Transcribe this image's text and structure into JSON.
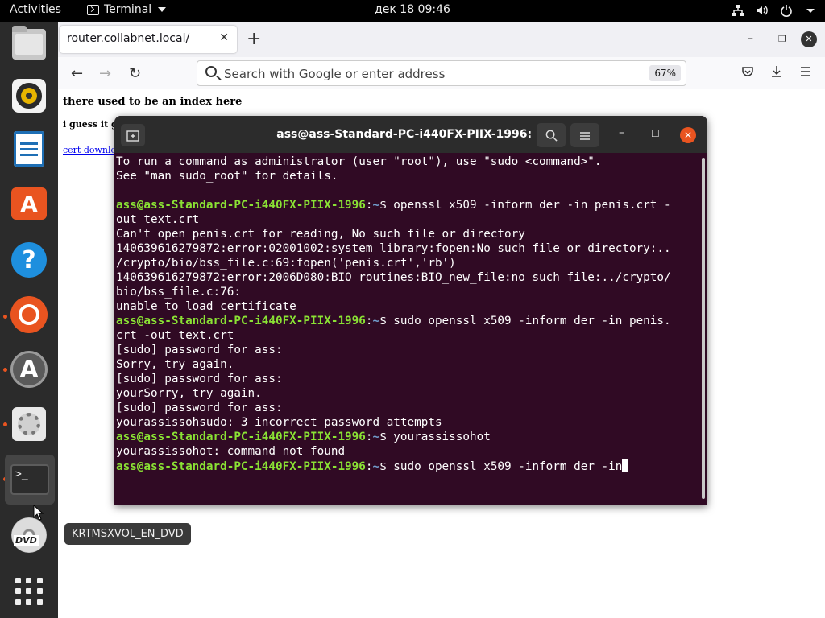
{
  "topbar": {
    "activities": "Activities",
    "app_name": "Terminal",
    "clock": "дек 18  09:46"
  },
  "dock": {
    "tooltip": "KRTMSXVOL_EN_DVD",
    "dvd_label": "DVD"
  },
  "browser": {
    "tab_title": "router.collabnet.local/",
    "url_placeholder": "Search with Google or enter address",
    "zoom": "67%",
    "page": {
      "heading": "there used to be an index here",
      "subheading": "i guess it g",
      "link": "cert downlo"
    }
  },
  "terminal": {
    "title": "ass@ass-Standard-PC-i440FX-PIIX-1996: ~",
    "lines": {
      "l1": "To run a command as administrator (user \"root\"), use \"sudo <command>\".",
      "l2": "See \"man sudo_root\" for details.",
      "prompt_user": "ass@ass-Standard-PC-i440FX-PIIX-1996",
      "prompt_sep": ":",
      "prompt_path": "~",
      "cmd1": "$ openssl x509 -inform der -in penis.crt -",
      "cmd1b": "out text.crt",
      "o1": "Can't open penis.crt for reading, No such file or directory",
      "o2": "140639616279872:error:02001002:system library:fopen:No such file or directory:..",
      "o3": "/crypto/bio/bss_file.c:69:fopen('penis.crt','rb')",
      "o4": "140639616279872:error:2006D080:BIO routines:BIO_new_file:no such file:../crypto/",
      "o5": "bio/bss_file.c:76:",
      "o6": "unable to load certificate",
      "cmd2": "$ sudo openssl x509 -inform der -in penis.",
      "cmd2b": "crt -out text.crt",
      "s1": "[sudo] password for ass:",
      "s2": "Sorry, try again.",
      "s3": "[sudo] password for ass:",
      "s4": "yourSorry, try again.",
      "s5": "[sudo] password for ass:",
      "s6": "yourassissohsudo: 3 incorrect password attempts",
      "cmd3": "$ yourassissohot",
      "o7": "yourassissohot: command not found",
      "cmd4": "$ sudo openssl x509 -inform der -in"
    }
  }
}
